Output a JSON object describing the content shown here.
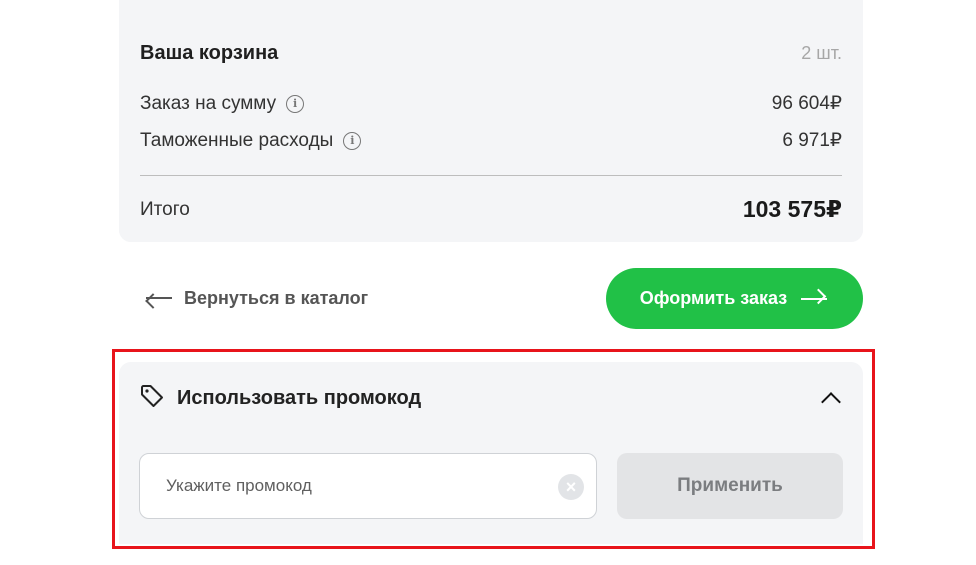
{
  "cart": {
    "title": "Ваша корзина",
    "count": "2 шт.",
    "order_sum_label": "Заказ на сумму",
    "order_sum_value": "96 604₽",
    "customs_label": "Таможенные расходы",
    "customs_value": "6 971₽",
    "total_label": "Итого",
    "total_value": "103 575₽"
  },
  "actions": {
    "back_label": "Вернуться в каталог",
    "order_label": "Оформить заказ",
    "order_color": "#21c147"
  },
  "promo": {
    "title": "Использовать промокод",
    "input_placeholder": "Укажите промокод",
    "input_value": "",
    "apply_label": "Применить",
    "clear_symbol": "×",
    "highlight_color": "#e8141b",
    "icons": [
      "tag-icon",
      "chevron-up-icon",
      "clear-icon"
    ]
  },
  "info_symbol": "i"
}
